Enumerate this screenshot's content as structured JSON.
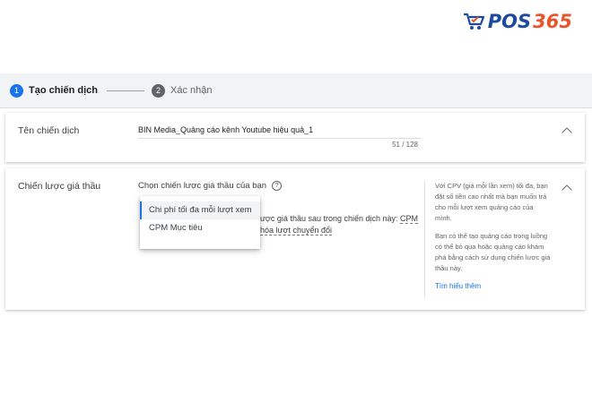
{
  "brand": {
    "logo_text": "POS",
    "logo_number": "365"
  },
  "stepper": {
    "steps": [
      {
        "number": "1",
        "label": "Tạo chiến dịch"
      },
      {
        "number": "2",
        "label": "Xác nhận"
      }
    ]
  },
  "campaign_name": {
    "label": "Tên chiến dịch",
    "value": "BIN Media_Quảng cáo kênh Youtube hiệu quả_1",
    "counter": "51 / 128"
  },
  "bidding": {
    "label": "Chiến lược giá thầu",
    "prompt": "Chọn chiến lược giá thầu của bạn",
    "help_icon": "help-circle-icon",
    "options": [
      {
        "label": "Chi phí tối đa mỗi lượt xem",
        "selected": true
      },
      {
        "label": "CPM Mục tiêu",
        "selected": false
      }
    ],
    "partial_text_1": "ược giá thầu sau trong chiến dịch này:",
    "partial_link_1": "CPM",
    "partial_text_2": "hóa lượt chuyển đổi",
    "side_panel": {
      "paragraph_1": "Với CPV (giá mỗi lần xem) tối đa, bạn đặt số tiền cao nhất mà bạn muốn trả cho mỗi lượt xem quảng cáo của mình.",
      "paragraph_2": "Bạn có thể tạo quảng cáo trong luồng có thể bỏ qua hoặc quảng cáo khám phá bằng cách sử dụng chiến lược giá thầu này.",
      "link": "Tìm hiểu thêm"
    }
  },
  "colors": {
    "accent": "#1a73e8",
    "brand_blue": "#1e4a9c",
    "brand_orange": "#e8542c"
  }
}
